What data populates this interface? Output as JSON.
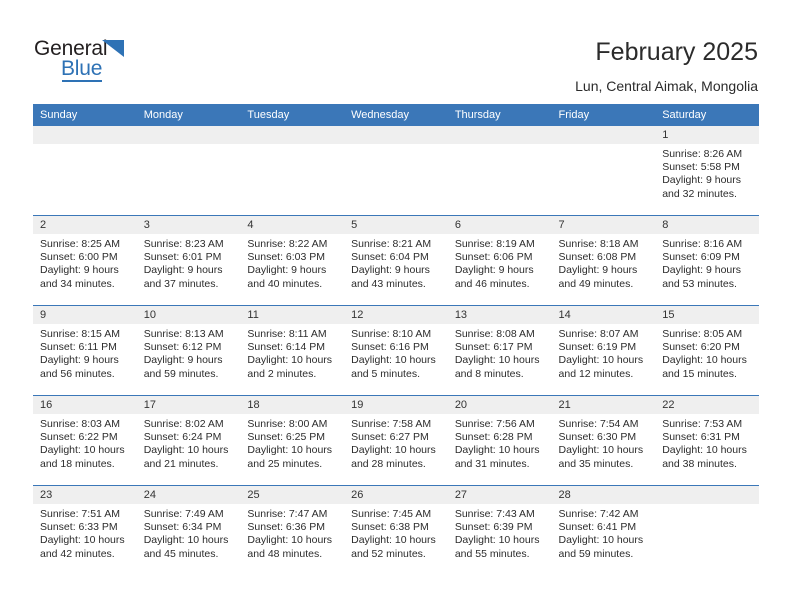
{
  "logo": {
    "word1": "General",
    "word2": "Blue",
    "accent_color": "#2e72b5"
  },
  "header": {
    "title": "February 2025",
    "location": "Lun, Central Aimak, Mongolia",
    "header_bg": "#3b77b8"
  },
  "weekdays": [
    "Sunday",
    "Monday",
    "Tuesday",
    "Wednesday",
    "Thursday",
    "Friday",
    "Saturday"
  ],
  "weeks": [
    [
      {
        "day": "",
        "empty": true,
        "sunrise": "",
        "sunset": "",
        "daylight_line1": "",
        "daylight_line2": ""
      },
      {
        "day": "",
        "empty": true,
        "sunrise": "",
        "sunset": "",
        "daylight_line1": "",
        "daylight_line2": ""
      },
      {
        "day": "",
        "empty": true,
        "sunrise": "",
        "sunset": "",
        "daylight_line1": "",
        "daylight_line2": ""
      },
      {
        "day": "",
        "empty": true,
        "sunrise": "",
        "sunset": "",
        "daylight_line1": "",
        "daylight_line2": ""
      },
      {
        "day": "",
        "empty": true,
        "sunrise": "",
        "sunset": "",
        "daylight_line1": "",
        "daylight_line2": ""
      },
      {
        "day": "",
        "empty": true,
        "sunrise": "",
        "sunset": "",
        "daylight_line1": "",
        "daylight_line2": ""
      },
      {
        "day": "1",
        "empty": false,
        "sunrise": "Sunrise: 8:26 AM",
        "sunset": "Sunset: 5:58 PM",
        "daylight_line1": "Daylight: 9 hours",
        "daylight_line2": "and 32 minutes."
      }
    ],
    [
      {
        "day": "2",
        "empty": false,
        "sunrise": "Sunrise: 8:25 AM",
        "sunset": "Sunset: 6:00 PM",
        "daylight_line1": "Daylight: 9 hours",
        "daylight_line2": "and 34 minutes."
      },
      {
        "day": "3",
        "empty": false,
        "sunrise": "Sunrise: 8:23 AM",
        "sunset": "Sunset: 6:01 PM",
        "daylight_line1": "Daylight: 9 hours",
        "daylight_line2": "and 37 minutes."
      },
      {
        "day": "4",
        "empty": false,
        "sunrise": "Sunrise: 8:22 AM",
        "sunset": "Sunset: 6:03 PM",
        "daylight_line1": "Daylight: 9 hours",
        "daylight_line2": "and 40 minutes."
      },
      {
        "day": "5",
        "empty": false,
        "sunrise": "Sunrise: 8:21 AM",
        "sunset": "Sunset: 6:04 PM",
        "daylight_line1": "Daylight: 9 hours",
        "daylight_line2": "and 43 minutes."
      },
      {
        "day": "6",
        "empty": false,
        "sunrise": "Sunrise: 8:19 AM",
        "sunset": "Sunset: 6:06 PM",
        "daylight_line1": "Daylight: 9 hours",
        "daylight_line2": "and 46 minutes."
      },
      {
        "day": "7",
        "empty": false,
        "sunrise": "Sunrise: 8:18 AM",
        "sunset": "Sunset: 6:08 PM",
        "daylight_line1": "Daylight: 9 hours",
        "daylight_line2": "and 49 minutes."
      },
      {
        "day": "8",
        "empty": false,
        "sunrise": "Sunrise: 8:16 AM",
        "sunset": "Sunset: 6:09 PM",
        "daylight_line1": "Daylight: 9 hours",
        "daylight_line2": "and 53 minutes."
      }
    ],
    [
      {
        "day": "9",
        "empty": false,
        "sunrise": "Sunrise: 8:15 AM",
        "sunset": "Sunset: 6:11 PM",
        "daylight_line1": "Daylight: 9 hours",
        "daylight_line2": "and 56 minutes."
      },
      {
        "day": "10",
        "empty": false,
        "sunrise": "Sunrise: 8:13 AM",
        "sunset": "Sunset: 6:12 PM",
        "daylight_line1": "Daylight: 9 hours",
        "daylight_line2": "and 59 minutes."
      },
      {
        "day": "11",
        "empty": false,
        "sunrise": "Sunrise: 8:11 AM",
        "sunset": "Sunset: 6:14 PM",
        "daylight_line1": "Daylight: 10 hours",
        "daylight_line2": "and 2 minutes."
      },
      {
        "day": "12",
        "empty": false,
        "sunrise": "Sunrise: 8:10 AM",
        "sunset": "Sunset: 6:16 PM",
        "daylight_line1": "Daylight: 10 hours",
        "daylight_line2": "and 5 minutes."
      },
      {
        "day": "13",
        "empty": false,
        "sunrise": "Sunrise: 8:08 AM",
        "sunset": "Sunset: 6:17 PM",
        "daylight_line1": "Daylight: 10 hours",
        "daylight_line2": "and 8 minutes."
      },
      {
        "day": "14",
        "empty": false,
        "sunrise": "Sunrise: 8:07 AM",
        "sunset": "Sunset: 6:19 PM",
        "daylight_line1": "Daylight: 10 hours",
        "daylight_line2": "and 12 minutes."
      },
      {
        "day": "15",
        "empty": false,
        "sunrise": "Sunrise: 8:05 AM",
        "sunset": "Sunset: 6:20 PM",
        "daylight_line1": "Daylight: 10 hours",
        "daylight_line2": "and 15 minutes."
      }
    ],
    [
      {
        "day": "16",
        "empty": false,
        "sunrise": "Sunrise: 8:03 AM",
        "sunset": "Sunset: 6:22 PM",
        "daylight_line1": "Daylight: 10 hours",
        "daylight_line2": "and 18 minutes."
      },
      {
        "day": "17",
        "empty": false,
        "sunrise": "Sunrise: 8:02 AM",
        "sunset": "Sunset: 6:24 PM",
        "daylight_line1": "Daylight: 10 hours",
        "daylight_line2": "and 21 minutes."
      },
      {
        "day": "18",
        "empty": false,
        "sunrise": "Sunrise: 8:00 AM",
        "sunset": "Sunset: 6:25 PM",
        "daylight_line1": "Daylight: 10 hours",
        "daylight_line2": "and 25 minutes."
      },
      {
        "day": "19",
        "empty": false,
        "sunrise": "Sunrise: 7:58 AM",
        "sunset": "Sunset: 6:27 PM",
        "daylight_line1": "Daylight: 10 hours",
        "daylight_line2": "and 28 minutes."
      },
      {
        "day": "20",
        "empty": false,
        "sunrise": "Sunrise: 7:56 AM",
        "sunset": "Sunset: 6:28 PM",
        "daylight_line1": "Daylight: 10 hours",
        "daylight_line2": "and 31 minutes."
      },
      {
        "day": "21",
        "empty": false,
        "sunrise": "Sunrise: 7:54 AM",
        "sunset": "Sunset: 6:30 PM",
        "daylight_line1": "Daylight: 10 hours",
        "daylight_line2": "and 35 minutes."
      },
      {
        "day": "22",
        "empty": false,
        "sunrise": "Sunrise: 7:53 AM",
        "sunset": "Sunset: 6:31 PM",
        "daylight_line1": "Daylight: 10 hours",
        "daylight_line2": "and 38 minutes."
      }
    ],
    [
      {
        "day": "23",
        "empty": false,
        "sunrise": "Sunrise: 7:51 AM",
        "sunset": "Sunset: 6:33 PM",
        "daylight_line1": "Daylight: 10 hours",
        "daylight_line2": "and 42 minutes."
      },
      {
        "day": "24",
        "empty": false,
        "sunrise": "Sunrise: 7:49 AM",
        "sunset": "Sunset: 6:34 PM",
        "daylight_line1": "Daylight: 10 hours",
        "daylight_line2": "and 45 minutes."
      },
      {
        "day": "25",
        "empty": false,
        "sunrise": "Sunrise: 7:47 AM",
        "sunset": "Sunset: 6:36 PM",
        "daylight_line1": "Daylight: 10 hours",
        "daylight_line2": "and 48 minutes."
      },
      {
        "day": "26",
        "empty": false,
        "sunrise": "Sunrise: 7:45 AM",
        "sunset": "Sunset: 6:38 PM",
        "daylight_line1": "Daylight: 10 hours",
        "daylight_line2": "and 52 minutes."
      },
      {
        "day": "27",
        "empty": false,
        "sunrise": "Sunrise: 7:43 AM",
        "sunset": "Sunset: 6:39 PM",
        "daylight_line1": "Daylight: 10 hours",
        "daylight_line2": "and 55 minutes."
      },
      {
        "day": "28",
        "empty": false,
        "sunrise": "Sunrise: 7:42 AM",
        "sunset": "Sunset: 6:41 PM",
        "daylight_line1": "Daylight: 10 hours",
        "daylight_line2": "and 59 minutes."
      },
      {
        "day": "",
        "empty": true,
        "sunrise": "",
        "sunset": "",
        "daylight_line1": "",
        "daylight_line2": ""
      }
    ]
  ]
}
